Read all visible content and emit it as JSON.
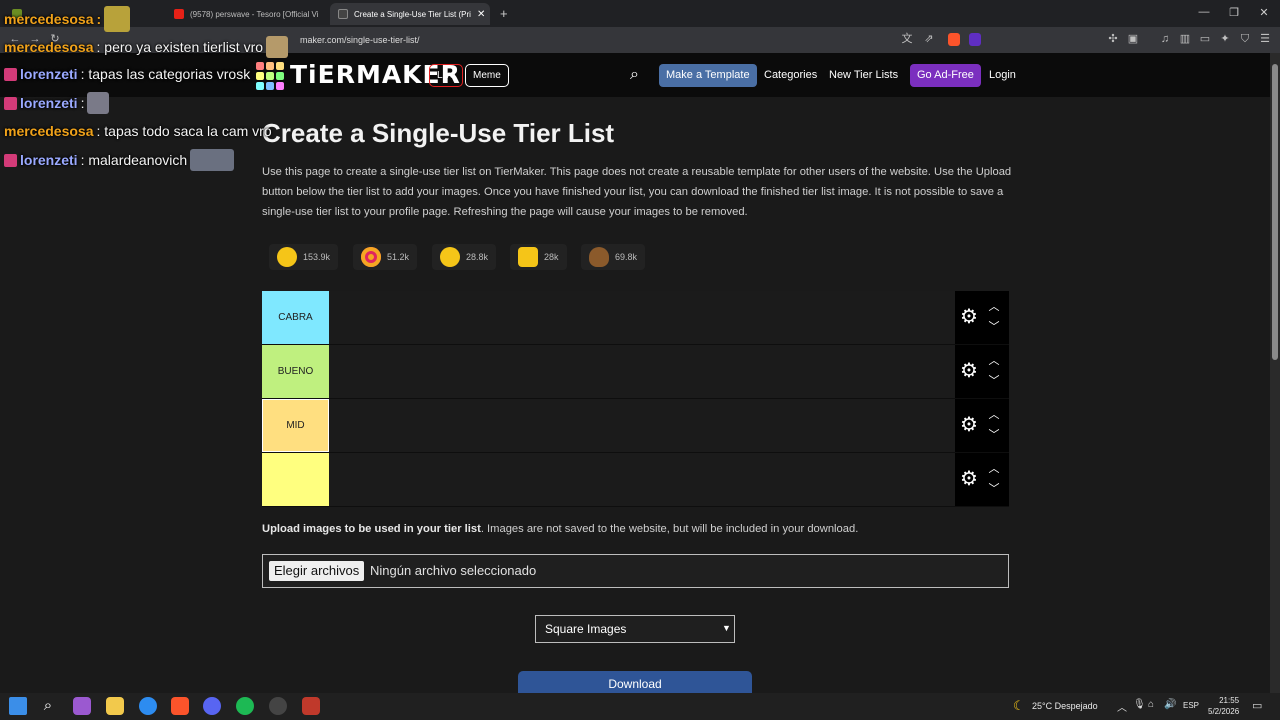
{
  "browser": {
    "tabs": [
      {
        "label": "",
        "favicon_color": "#6b8e23"
      },
      {
        "label": "(9578) perswave - Tesoro [Official Vi",
        "favicon_color": "#e62117"
      },
      {
        "label": "Create a Single-Use Tier List (Pri",
        "favicon_color": "#444444"
      }
    ],
    "new_tab": "+",
    "url": "maker.com/single-use-tier-list/",
    "window_controls": [
      "—",
      "❐",
      "✕"
    ]
  },
  "chat_overlay": [
    {
      "user": "mercedesosa",
      "message": "",
      "user_color": "#f0a21a",
      "mod": false,
      "emote": true
    },
    {
      "user": "mercedesosa",
      "message": ": pero ya existen tierlist vro",
      "user_color": "#f0a21a",
      "mod": false,
      "emote": true
    },
    {
      "user": "lorenzeti",
      "message": ": tapas las categorias vrosk",
      "user_color": "#9aa9ff",
      "mod": true,
      "emote": false
    },
    {
      "user": "lorenzeti",
      "message": ":",
      "user_color": "#9aa9ff",
      "mod": true,
      "emote": true
    },
    {
      "user": "mercedesosa",
      "message": ": tapas todo saca la cam vro",
      "user_color": "#f0a21a",
      "mod": false,
      "emote": false
    },
    {
      "user": "lorenzeti",
      "message": ": malardeanovich",
      "user_color": "#9aa9ff",
      "mod": true,
      "emote": true
    }
  ],
  "header": {
    "logo": "TiERMAKER",
    "live_label": "Live",
    "meme_label": "Meme",
    "make_template_label": "Make a Template",
    "categories_label": "Categories",
    "new_tier_lists_label": "New Tier Lists",
    "go_ad_free_label": "Go Ad-Free",
    "login_label": "Login",
    "search_icon": "search-icon"
  },
  "page": {
    "title": "Create a Single-Use Tier List",
    "intro": "Use this page to create a single-use tier list on TierMaker. This page does not create a reusable template for other users of the website. Use the Upload button below the tier list to add your images. Once you have finished your list, you can download the finished tier list image. It is not possible to save a single-use tier list to your profile page. Refreshing the page will cause your images to be removed.",
    "reactions": [
      {
        "icon": "smile-emoji",
        "count": "153.9k",
        "color": "#f5c518"
      },
      {
        "icon": "heart-eyes-emoji",
        "count": "51.2k",
        "color": "#f5a623"
      },
      {
        "icon": "laugh-emoji",
        "count": "28.8k",
        "color": "#f5c518"
      },
      {
        "icon": "raised-hands-emoji",
        "count": "28k",
        "color": "#f5c518"
      },
      {
        "icon": "poop-emoji",
        "count": "69.8k",
        "color": "#8b5a2b"
      }
    ]
  },
  "tiers": [
    {
      "label": "CABRA",
      "color": "#7fe8ff"
    },
    {
      "label": "BUENO",
      "color": "#bff07f"
    },
    {
      "label": "MID",
      "color": "#ffdf80"
    },
    {
      "label": "",
      "color": "#ffff7f"
    }
  ],
  "upload": {
    "label_bold": "Upload images to be used in your tier list",
    "label_rest": ". Images are not saved to the website, but will be included in your download.",
    "choose_button": "Elegir archivos",
    "status": "Ningún archivo seleccionado"
  },
  "image_shape": {
    "selected": "Square Images"
  },
  "download_label": "Download",
  "taskbar": {
    "weather": "25°C  Despejado",
    "language": "ESP",
    "time": "21:55",
    "date": "5/2/2026"
  },
  "colors": {
    "make_template_bg": "#4a6fa5",
    "go_ad_free_bg": "#7b2fbf",
    "live_border": "#e02020"
  }
}
